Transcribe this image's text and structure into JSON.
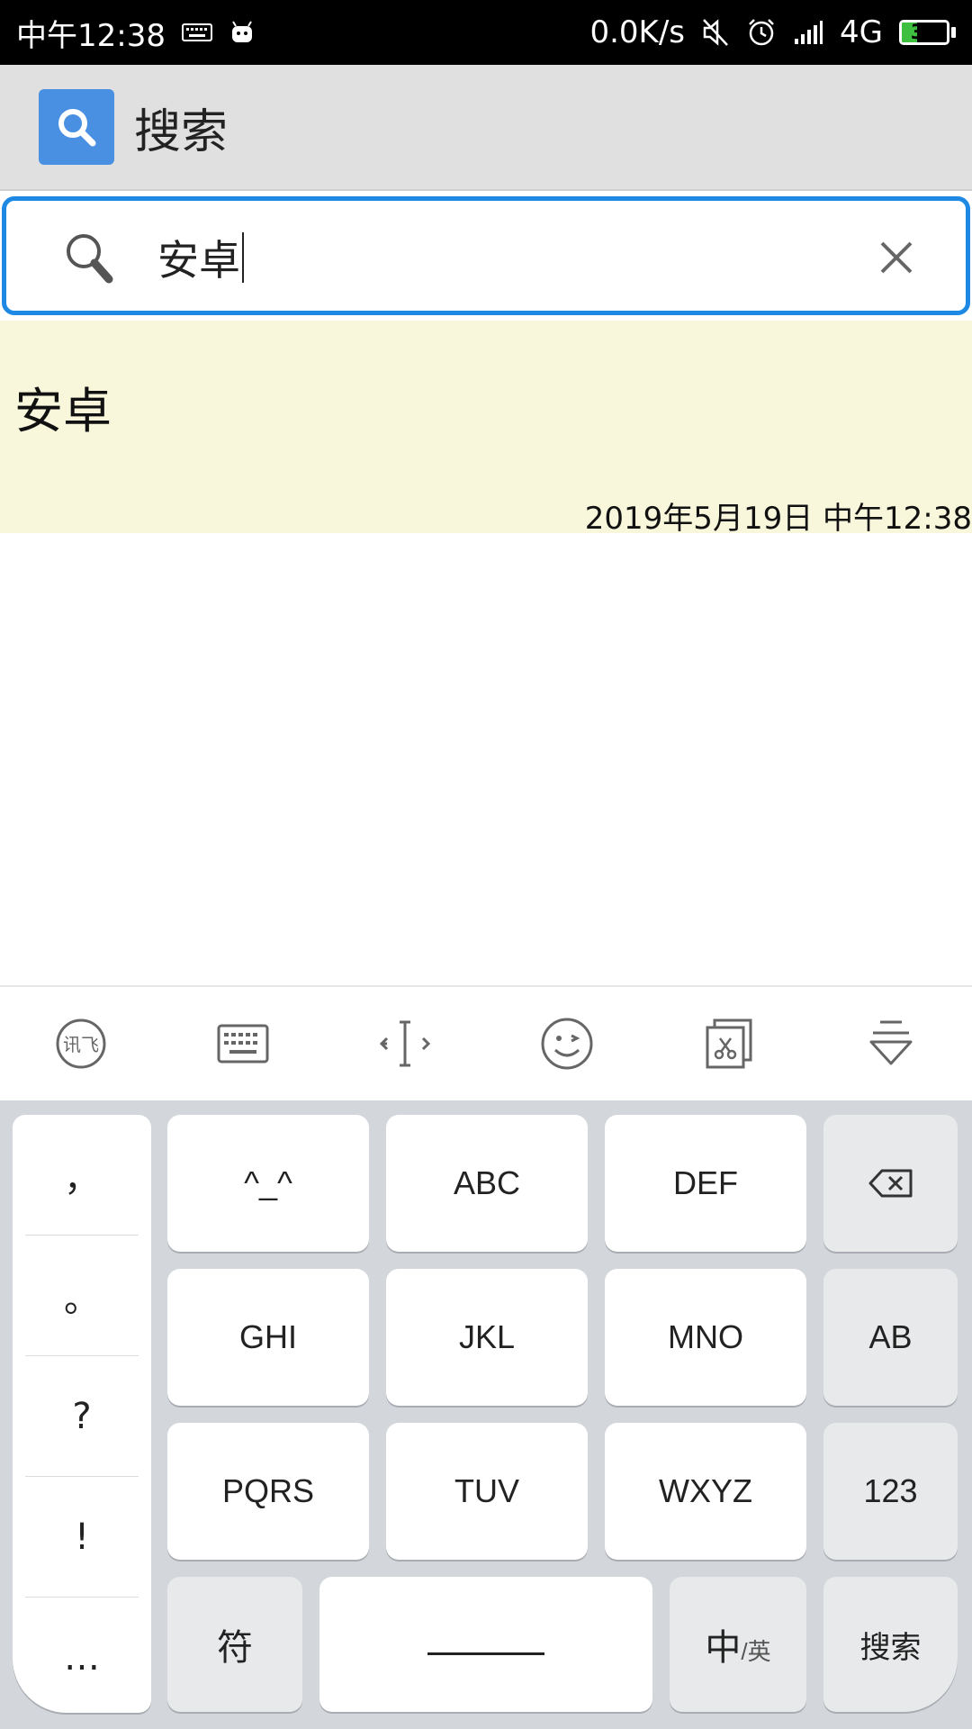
{
  "status_bar": {
    "time": "中午12:38",
    "speed": "0.0K/s",
    "network": "4G",
    "battery": "33",
    "battery_level": 0.33,
    "icons": [
      "keyboard-icon",
      "android-icon",
      "mute-icon",
      "alarm-icon",
      "signal-icon"
    ]
  },
  "app_bar": {
    "title": "搜索",
    "icon": "search-icon",
    "accent": "#4a90e2"
  },
  "search": {
    "value": "安卓",
    "border_color": "#1e88e5"
  },
  "results": [
    {
      "title": "安卓",
      "time": "2019年5月19日 中午12:38",
      "bg": "#f8f7dc"
    }
  ],
  "keyboard": {
    "toolbar": [
      "xunfei-icon",
      "keyboard-icon",
      "cursor-move-icon",
      "emoji-icon",
      "clipboard-icon",
      "collapse-keyboard-icon"
    ],
    "punctuation": [
      "，",
      "。",
      "?",
      "!",
      "…"
    ],
    "keys": {
      "emoticon": "^_^",
      "abc": "ABC",
      "def": "DEF",
      "ghi": "GHI",
      "jkl": "JKL",
      "mno": "MNO",
      "ab": "AB",
      "pqrs": "PQRS",
      "tuv": "TUV",
      "wxyz": "WXYZ",
      "num": "123",
      "symbol": "符",
      "zh": "中",
      "en": "英",
      "search": "搜索"
    }
  }
}
